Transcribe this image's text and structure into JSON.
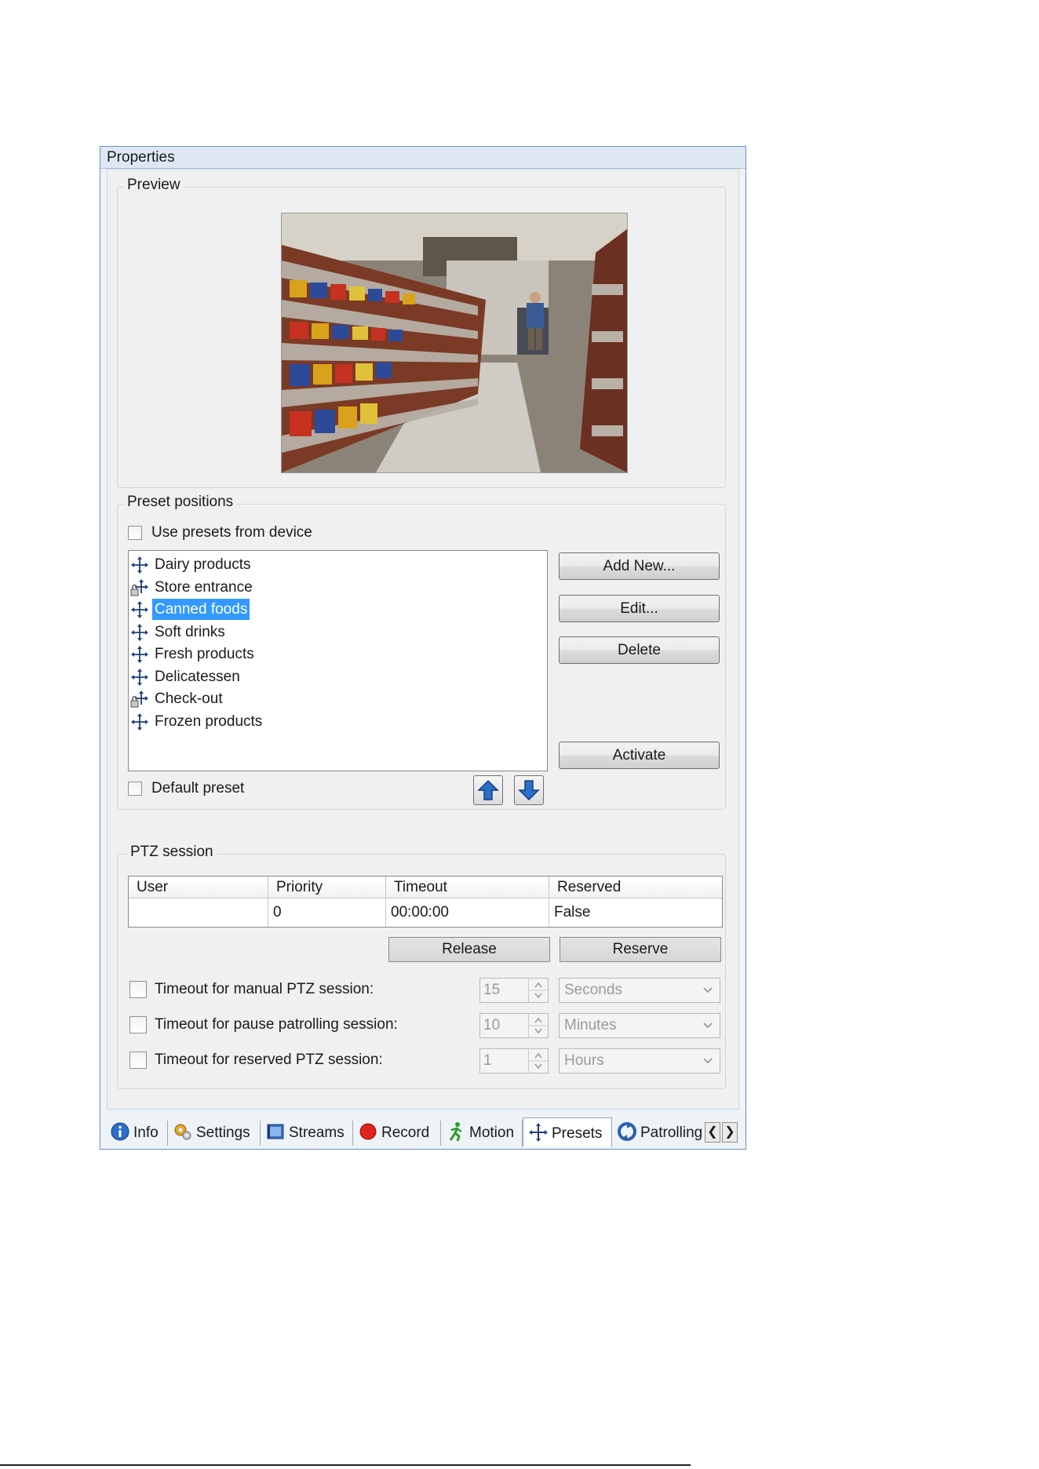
{
  "window": {
    "title": "Properties"
  },
  "preview": {
    "label": "Preview",
    "image_alt": "Supermarket aisle camera preview"
  },
  "preset_positions": {
    "label": "Preset positions",
    "use_presets_label": "Use presets from device",
    "use_presets_checked": false,
    "items": [
      {
        "label": "Dairy products",
        "icon": "ptz-move-icon",
        "selected": false
      },
      {
        "label": "Store entrance",
        "icon": "ptz-locked-icon",
        "selected": false
      },
      {
        "label": "Canned foods",
        "icon": "ptz-move-icon",
        "selected": true
      },
      {
        "label": "Soft drinks",
        "icon": "ptz-move-icon",
        "selected": false
      },
      {
        "label": "Fresh products",
        "icon": "ptz-move-icon",
        "selected": false
      },
      {
        "label": "Delicatessen",
        "icon": "ptz-move-icon",
        "selected": false
      },
      {
        "label": "Check-out",
        "icon": "ptz-locked-icon",
        "selected": false
      },
      {
        "label": "Frozen products",
        "icon": "ptz-move-icon",
        "selected": false
      }
    ],
    "buttons": {
      "add_new": "Add New...",
      "edit": "Edit...",
      "delete": "Delete",
      "activate": "Activate"
    },
    "default_preset_label": "Default preset",
    "default_preset_checked": false,
    "move_up_icon": "arrow-up-icon",
    "move_down_icon": "arrow-down-icon"
  },
  "ptz_session": {
    "label": "PTZ session",
    "columns": [
      "User",
      "Priority",
      "Timeout",
      "Reserved"
    ],
    "row": [
      "",
      "0",
      "00:00:00",
      "False"
    ],
    "release_label": "Release",
    "reserve_label": "Reserve",
    "timeouts": [
      {
        "label": "Timeout for manual PTZ session:",
        "value": "15",
        "unit": "Seconds",
        "checked": false
      },
      {
        "label": "Timeout for pause patrolling session:",
        "value": "10",
        "unit": "Minutes",
        "checked": false
      },
      {
        "label": "Timeout for reserved PTZ session:",
        "value": "1",
        "unit": "Hours",
        "checked": false
      }
    ]
  },
  "tabs": [
    {
      "label": "Info",
      "icon": "info-icon",
      "active": false
    },
    {
      "label": "Settings",
      "icon": "settings-icon",
      "active": false
    },
    {
      "label": "Streams",
      "icon": "streams-icon",
      "active": false
    },
    {
      "label": "Record",
      "icon": "record-icon",
      "active": false
    },
    {
      "label": "Motion",
      "icon": "motion-icon",
      "active": false
    },
    {
      "label": "Presets",
      "icon": "presets-icon",
      "active": true
    },
    {
      "label": "Patrolling",
      "icon": "patrolling-icon",
      "active": false
    }
  ],
  "colors": {
    "selection": "#3399ff",
    "window_border": "#6d8fb8",
    "record_red": "#e0241b",
    "motion_green": "#2e9a2e",
    "info_blue": "#2a6fc9"
  }
}
